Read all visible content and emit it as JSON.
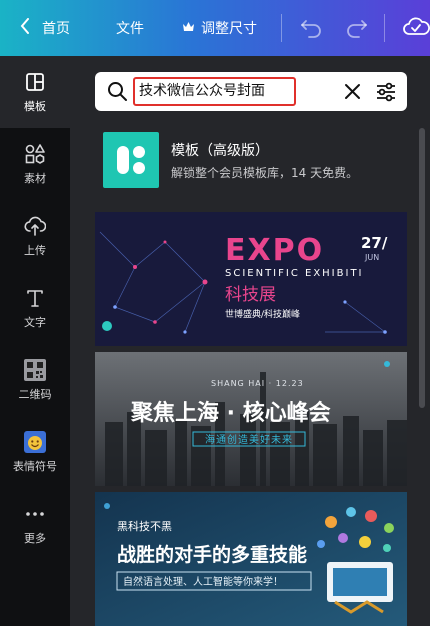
{
  "topbar": {
    "home_label": "首页",
    "file_label": "文件",
    "resize_label": "调整尺寸"
  },
  "rail": {
    "items": [
      {
        "label": "模板",
        "icon": "template-icon"
      },
      {
        "label": "素材",
        "icon": "elements-icon"
      },
      {
        "label": "上传",
        "icon": "upload-icon"
      },
      {
        "label": "文字",
        "icon": "text-icon"
      },
      {
        "label": "二维码",
        "icon": "qrcode-icon"
      },
      {
        "label": "表情符号",
        "icon": "emoji-icon"
      },
      {
        "label": "更多",
        "icon": "more-icon"
      }
    ]
  },
  "search": {
    "value": "技术微信公众号封面"
  },
  "premium": {
    "title": "模板（高级版）",
    "subtitle": "解锁整个会员模板库，14 天免费。"
  },
  "templates": [
    {
      "title": "EXPO",
      "subtitle": "SCIENTIFIC EXHIBITI",
      "date_day": "27/",
      "date_month": "JUN",
      "cn_title": "科技展",
      "tagline": "世博盛典/科技巅峰",
      "colors": {
        "bg": "#181a3c",
        "accent": "#e9458d"
      }
    },
    {
      "top_text": "SHANG HAI · 12.23",
      "title": "聚焦上海 · 核心峰会",
      "subtitle": "海通创造美好未来",
      "colors": {
        "bg": "#3b3f44",
        "accent": "#35b9d9"
      }
    },
    {
      "kicker": "黑科技不黑",
      "title": "战胜的对手的多重技能",
      "subtitle": "自然语言处理、人工智能等你来学！",
      "colors": {
        "bg": "#1e4a66",
        "accent": "#3fa0d4"
      }
    }
  ]
}
